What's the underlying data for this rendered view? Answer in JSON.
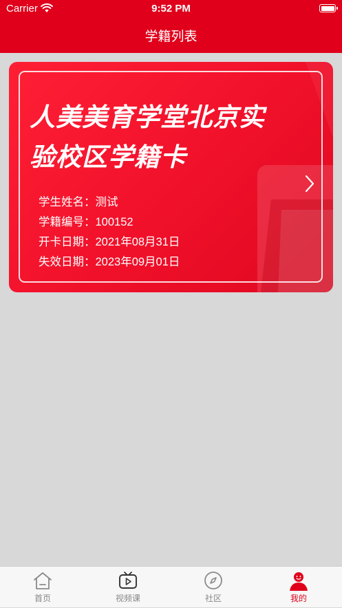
{
  "status": {
    "carrier": "Carrier",
    "time": "9:52 PM"
  },
  "nav": {
    "title": "学籍列表"
  },
  "card": {
    "title_line1": "人美美育学堂北京实",
    "title_line2": "验校区学籍卡",
    "fields": [
      {
        "label": "学生姓名：",
        "value": "测试"
      },
      {
        "label": "学籍编号：",
        "value": "100152"
      },
      {
        "label": "开卡日期：",
        "value": "2021年08月31日"
      },
      {
        "label": "失效日期：",
        "value": "2023年09月01日"
      }
    ],
    "color": "#f0102a"
  },
  "tabs": [
    {
      "label": "首页",
      "icon": "home-icon",
      "active": false
    },
    {
      "label": "视频课",
      "icon": "tv-play-icon",
      "active": false
    },
    {
      "label": "社区",
      "icon": "compass-icon",
      "active": false
    },
    {
      "label": "我的",
      "icon": "profile-icon",
      "active": true
    }
  ],
  "colors": {
    "accent": "#e0001b",
    "background": "#d8d8d8",
    "tab_inactive": "#888888"
  }
}
